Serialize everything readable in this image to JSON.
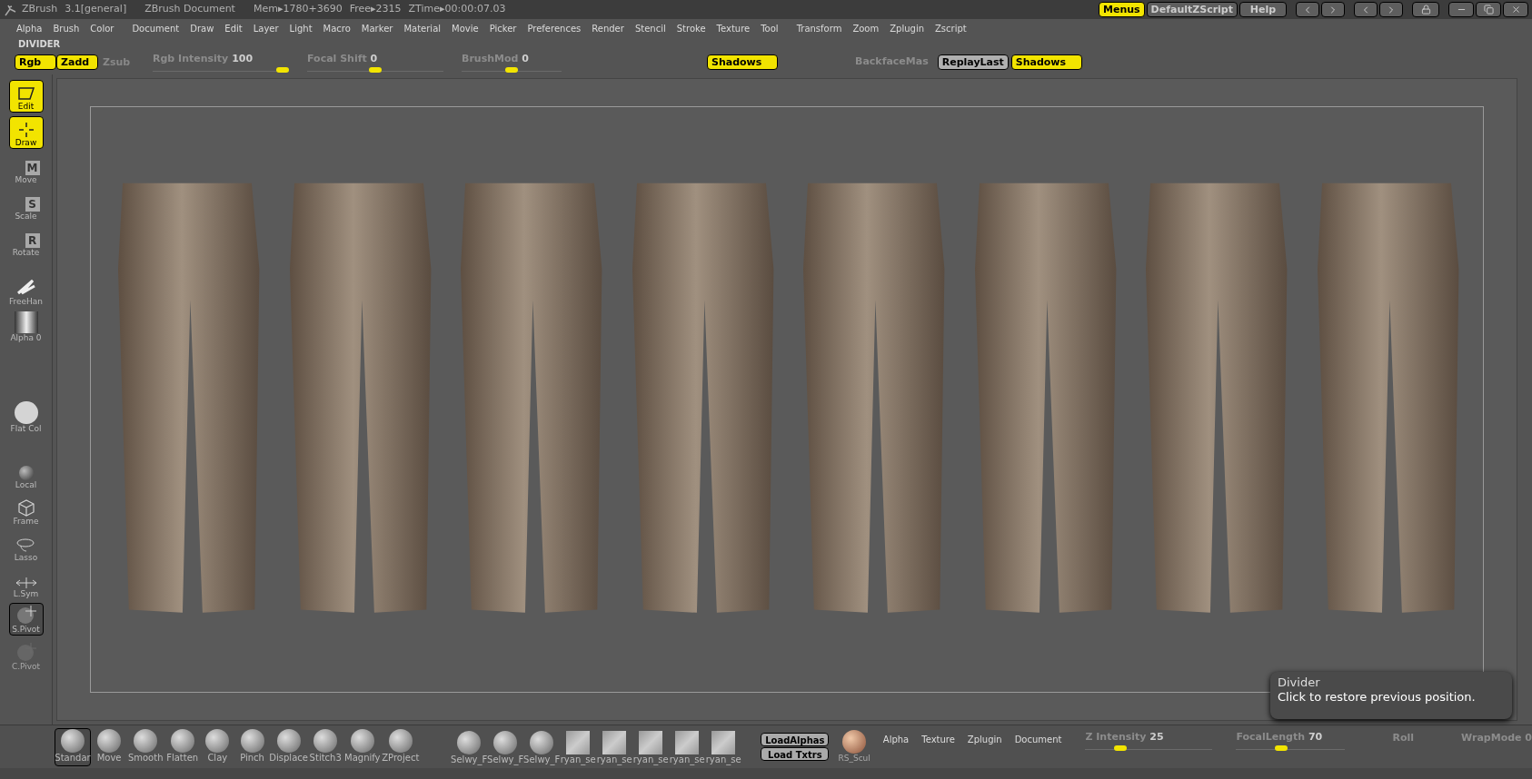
{
  "title_bar": {
    "app": "ZBrush",
    "version": "3.1[general]",
    "document": "ZBrush Document",
    "mem": "Mem▸1780+3690",
    "free": "Free▸2315",
    "ztime": "ZTime▸00:00:07.03",
    "buttons": [
      {
        "label": "Menus",
        "selected": true
      },
      {
        "label": "DefaultZScript",
        "selected": false
      },
      {
        "label": "Help",
        "selected": false
      }
    ]
  },
  "menu": [
    "Alpha",
    "Brush",
    "Color",
    "Document",
    "Draw",
    "Edit",
    "Layer",
    "Light",
    "Macro",
    "Marker",
    "Material",
    "Movie",
    "Picker",
    "Preferences",
    "Render",
    "Stencil",
    "Stroke",
    "Texture",
    "Tool",
    "Transform",
    "Zoom",
    "Zplugin",
    "Zscript"
  ],
  "divider_label": "DIVIDER",
  "tool_row": [
    {
      "kind": "toggle",
      "label": "Rgb",
      "on": true
    },
    {
      "kind": "toggle",
      "label": "Zadd",
      "on": true
    },
    {
      "kind": "toggle",
      "label": "Zsub",
      "on": false
    },
    {
      "kind": "slider",
      "label": "Rgb Intensity",
      "value": "100",
      "level": 1
    },
    {
      "kind": "slider",
      "label": "Focal Shift",
      "value": "0",
      "level": 0.5
    },
    {
      "kind": "slider",
      "label": "BrushMod",
      "value": "0",
      "level": 0.5
    },
    {
      "kind": "wide",
      "label": "Shadows",
      "on": true
    },
    {
      "kind": "text",
      "label": "BackfaceMas",
      "on": false
    },
    {
      "kind": "toggle",
      "label": "ReplayLast",
      "on": false
    },
    {
      "kind": "wide",
      "label": "Shadows",
      "on": true
    }
  ],
  "left_tools": [
    {
      "label": "Edit",
      "kind": "edit",
      "selected": true,
      "disabled": false
    },
    {
      "label": "Draw",
      "kind": "draw",
      "selected": true,
      "disabled": false
    },
    {
      "label": "Move",
      "kind": "letter",
      "letter": "M",
      "selected": false,
      "disabled": false
    },
    {
      "label": "Scale",
      "kind": "letter",
      "letter": "S",
      "selected": false,
      "disabled": false
    },
    {
      "label": "Rotate",
      "kind": "letter",
      "letter": "R",
      "selected": false,
      "disabled": false
    },
    {
      "label": "FreeHan",
      "kind": "stroke",
      "selected": false,
      "disabled": false
    },
    {
      "label": "Alpha 0",
      "kind": "alpha",
      "selected": false,
      "disabled": false
    },
    {
      "label": "Flat Col",
      "kind": "color",
      "selected": false,
      "disabled": false
    },
    {
      "label": "Local",
      "kind": "local",
      "selected": false,
      "disabled": false
    },
    {
      "label": "Frame",
      "kind": "frame",
      "selected": false,
      "disabled": false
    },
    {
      "label": "Lasso",
      "kind": "lasso",
      "selected": false,
      "disabled": false
    },
    {
      "label": "L.Sym",
      "kind": "sym",
      "selected": false,
      "disabled": false
    },
    {
      "label": "S.Pivot",
      "kind": "pivot",
      "selected": true,
      "disabled": false
    },
    {
      "label": "C.Pivot",
      "kind": "pivot",
      "selected": false,
      "disabled": true
    }
  ],
  "brushes": [
    {
      "label": "Standar",
      "selected": true
    },
    {
      "label": "Move",
      "selected": false
    },
    {
      "label": "Smooth",
      "selected": false
    },
    {
      "label": "Flatten",
      "selected": false
    },
    {
      "label": "Clay",
      "selected": false
    },
    {
      "label": "Pinch",
      "selected": false
    },
    {
      "label": "Displace",
      "selected": false
    },
    {
      "label": "Stitch3",
      "selected": false
    },
    {
      "label": "Magnify",
      "selected": false
    },
    {
      "label": "ZProject",
      "selected": false
    }
  ],
  "alphas": [
    {
      "label": "Selwy_F",
      "kind": "swirl"
    },
    {
      "label": "Selwy_F",
      "kind": "swirl"
    },
    {
      "label": "Selwy_F",
      "kind": "swirl"
    },
    {
      "label": "ryan_se",
      "kind": "patch"
    },
    {
      "label": "ryan_se",
      "kind": "patch"
    },
    {
      "label": "ryan_se",
      "kind": "patch"
    },
    {
      "label": "ryan_se",
      "kind": "patch"
    },
    {
      "label": "ryan_se",
      "kind": "patch"
    }
  ],
  "load_buttons": [
    "LoadAlphas",
    "Load Txtrs"
  ],
  "material": "RS_Scul",
  "tray_menu": [
    "Alpha",
    "Texture",
    "Zplugin",
    "Document"
  ],
  "tray_sliders": [
    {
      "label": "Z Intensity",
      "value": "25",
      "level": 0.25
    },
    {
      "label": "FocalLength",
      "value": "70",
      "level": 0.4
    }
  ],
  "tray_tail": [
    {
      "label": "Roll"
    },
    {
      "label": "WrapMode 0"
    }
  ],
  "tooltip": {
    "title": "Divider",
    "text": "Click to restore previous position."
  }
}
